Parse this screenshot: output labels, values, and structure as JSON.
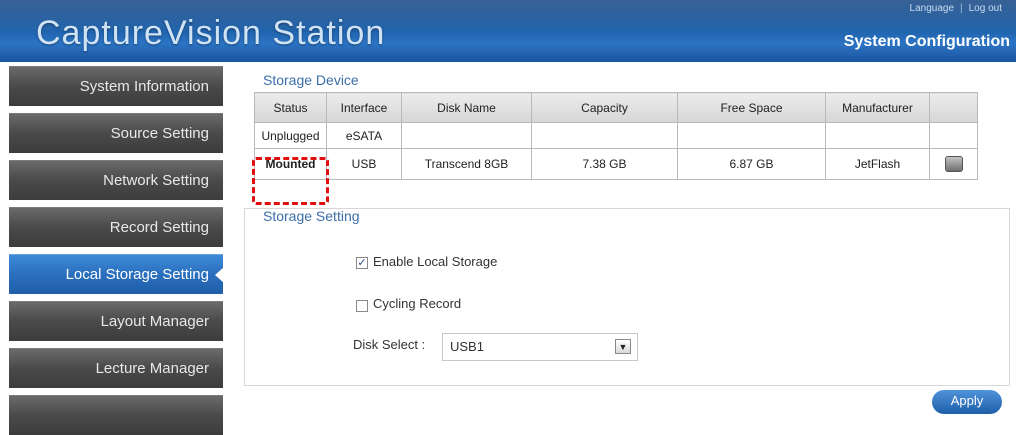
{
  "header": {
    "app_title": "CaptureVision Station",
    "language_label": "Language",
    "logout_label": "Log out",
    "page_title": "System Configuration"
  },
  "sidebar": {
    "items": [
      {
        "label": "System Information",
        "active": false
      },
      {
        "label": "Source Setting",
        "active": false
      },
      {
        "label": "Network Setting",
        "active": false
      },
      {
        "label": "Record Setting",
        "active": false
      },
      {
        "label": "Local Storage Setting",
        "active": true
      },
      {
        "label": "Layout Manager",
        "active": false
      },
      {
        "label": "Lecture Manager",
        "active": false
      }
    ]
  },
  "storage_device": {
    "title": "Storage Device",
    "columns": [
      "Status",
      "Interface",
      "Disk Name",
      "Capacity",
      "Free Space",
      "Manufacturer",
      ""
    ],
    "rows": [
      {
        "status": "Unplugged",
        "interface": "eSATA",
        "disk_name": "",
        "capacity": "",
        "free_space": "",
        "manufacturer": "",
        "icon": ""
      },
      {
        "status": "Mounted",
        "interface": "USB",
        "disk_name": "Transcend 8GB",
        "capacity": "7.38 GB",
        "free_space": "6.87 GB",
        "manufacturer": "JetFlash",
        "icon": "disk-icon"
      }
    ]
  },
  "storage_setting": {
    "title": "Storage Setting",
    "enable_local_storage": {
      "label": "Enable Local Storage",
      "checked": true
    },
    "cycling_record": {
      "label": "Cycling Record",
      "checked": false
    },
    "disk_select": {
      "label": "Disk Select :",
      "value": "USB1"
    }
  },
  "actions": {
    "apply_label": "Apply"
  },
  "colors": {
    "header_blue": "#1d5fa8",
    "active_tab_blue": "#2a6fbe",
    "highlight_red": "#e01010"
  }
}
